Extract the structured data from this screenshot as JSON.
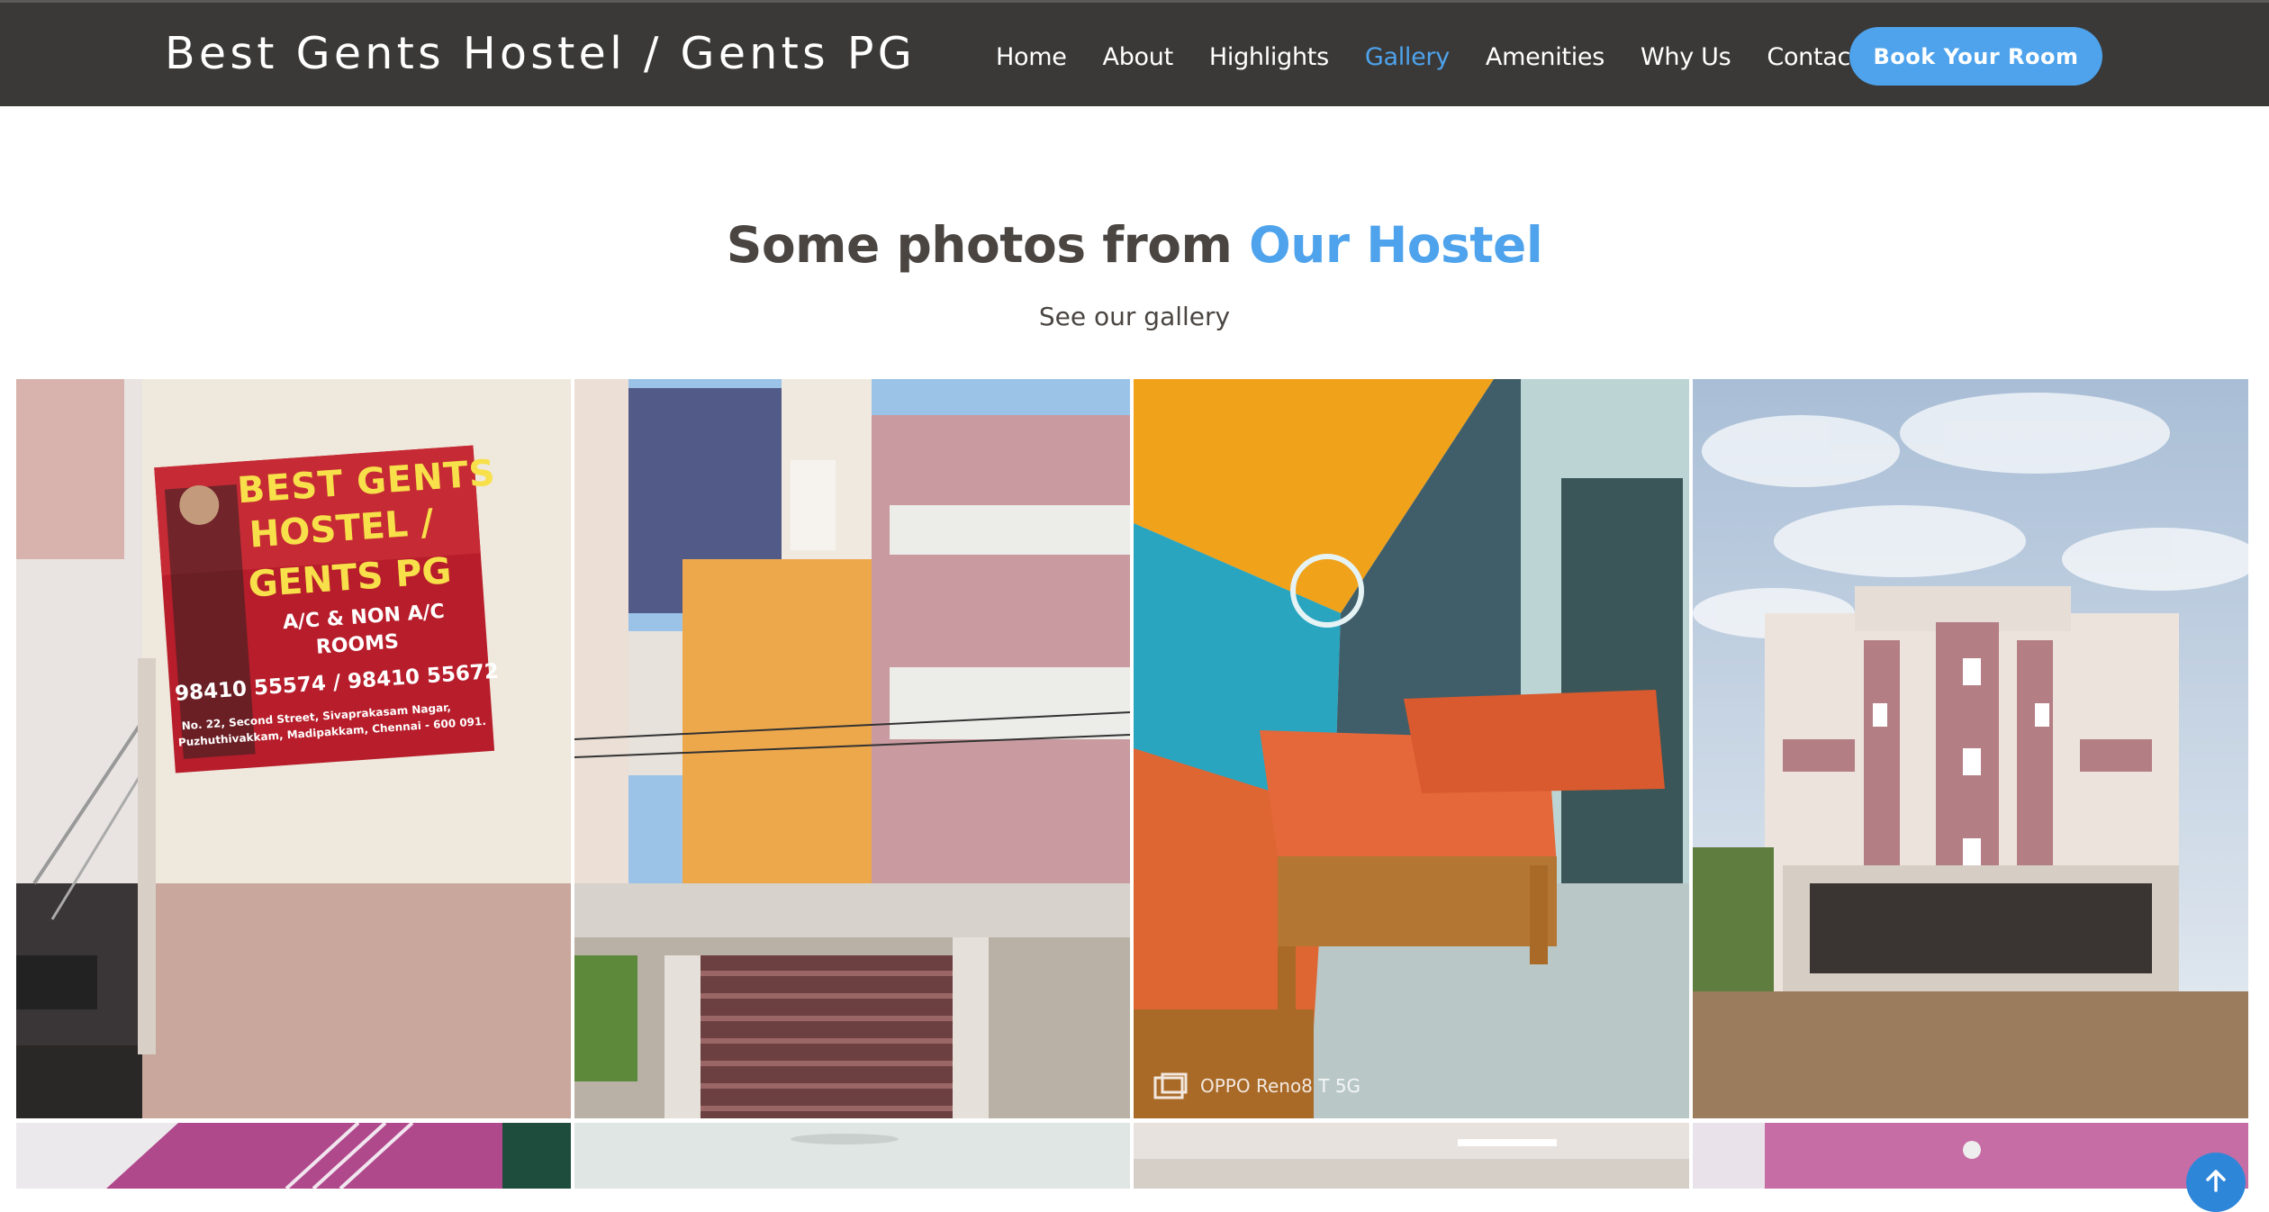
{
  "header": {
    "brand": "Best Gents Hostel / Gents PG",
    "nav": [
      {
        "label": "Home"
      },
      {
        "label": "About"
      },
      {
        "label": "Highlights"
      },
      {
        "label": "Gallery",
        "active": true
      },
      {
        "label": "Amenities"
      },
      {
        "label": "Why Us"
      },
      {
        "label": "Contact"
      }
    ],
    "cta": "Book Your Room"
  },
  "section": {
    "title_prefix": "Some photos from",
    "title_accent": "Our Hostel",
    "subtitle": "See our gallery"
  },
  "gallery": {
    "sign": {
      "line1": "BEST GENTS",
      "line2": "HOSTEL /",
      "line3": "GENTS PG",
      "line4": "A/C &  NON A/C",
      "line5": "ROOMS",
      "phones": "98410 55574 / 98410 55672",
      "address1": "No. 22, Second Street, Sivaprakasam Nagar,",
      "address2": "Puzhuthivakkam, Madipakkam, Chennai - 600 091."
    },
    "watermark": "OPPO Reno8 T 5G"
  },
  "colors": {
    "header_bg": "#3a3938",
    "accent": "#4ea3ec",
    "title_text": "#4a4541"
  },
  "icons": {
    "scroll_top": "arrow-up-icon"
  }
}
